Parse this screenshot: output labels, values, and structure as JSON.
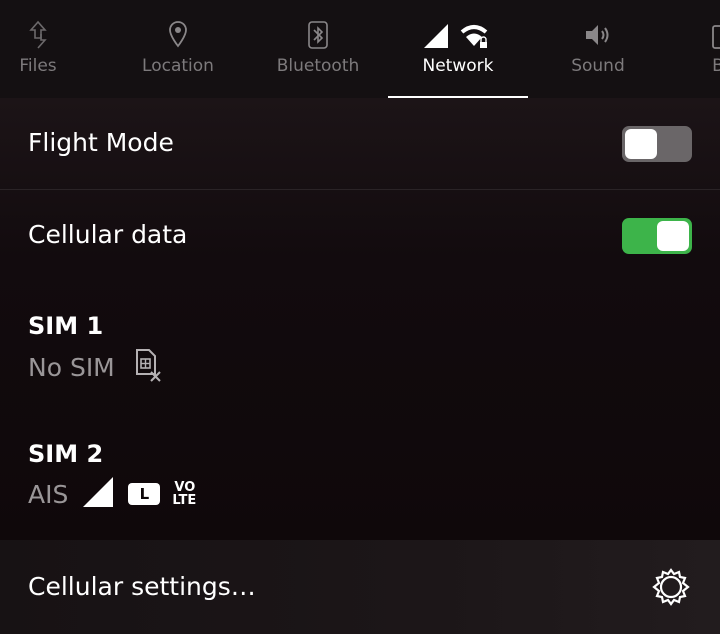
{
  "tabs": [
    {
      "label": "Files",
      "icon": "files-icon"
    },
    {
      "label": "Location",
      "icon": "location-pin-icon"
    },
    {
      "label": "Bluetooth",
      "icon": "bluetooth-icon"
    },
    {
      "label": "Network",
      "icon": "network-signal-wifi-icon",
      "active": true
    },
    {
      "label": "Sound",
      "icon": "speaker-icon"
    },
    {
      "label": "B",
      "icon": "battery-icon"
    }
  ],
  "flight_mode": {
    "label": "Flight Mode",
    "enabled": false
  },
  "cellular_data": {
    "label": "Cellular data",
    "enabled": true
  },
  "sim1": {
    "title": "SIM 1",
    "status": "No SIM",
    "icon": "sim-missing-icon"
  },
  "sim2": {
    "title": "SIM 2",
    "carrier": "AIS",
    "network_badge": "L",
    "volte_top": "VO",
    "volte_bottom": "LTE"
  },
  "cellular_settings": {
    "label": "Cellular settings…",
    "icon": "gear-icon"
  },
  "colors": {
    "toggle_on": "#3db44a",
    "toggle_off": "#6a6668",
    "background": "#0d0709"
  }
}
